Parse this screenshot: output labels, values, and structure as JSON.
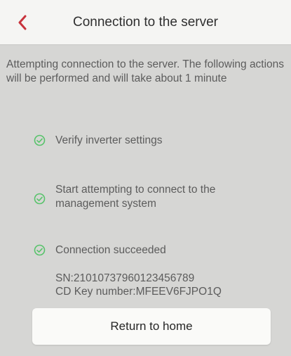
{
  "header": {
    "title": "Connection to the server"
  },
  "intro": "Attempting connection to the server. The following actions will be performed and will take about 1 minute",
  "steps": [
    {
      "label": "Verify inverter settings",
      "status": "done"
    },
    {
      "label": "Start attempting to connect to the management system",
      "status": "done"
    },
    {
      "label": "Connection succeeded",
      "status": "done"
    }
  ],
  "details": {
    "sn": "SN:21010737960123456789",
    "cd_key": "CD Key number:MFEEV6FJPO1Q"
  },
  "home_button": {
    "label": "Return to home"
  },
  "icons": {
    "back": "chevron-left-icon",
    "step_status": "check-circle-icon"
  },
  "colors": {
    "accent_back": "#c8333c",
    "check_green": "#58c36b",
    "background": "#d6d6d4"
  }
}
